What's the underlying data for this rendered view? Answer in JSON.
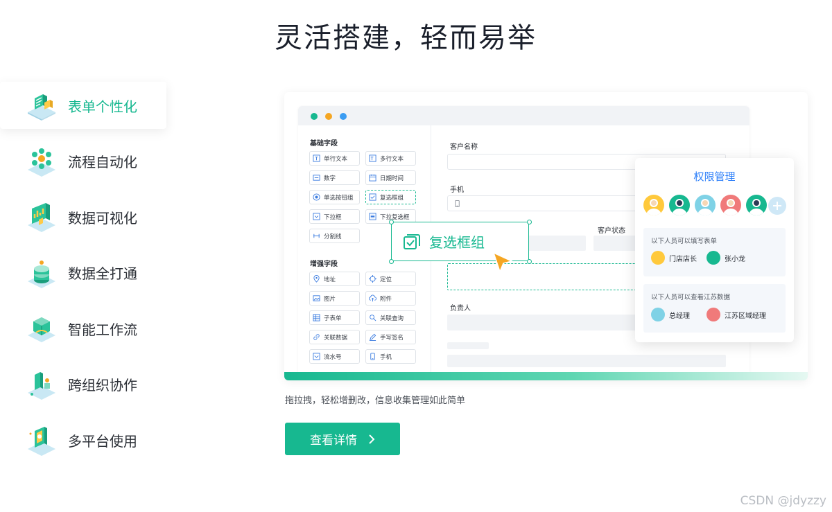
{
  "page": {
    "title": "灵活搭建，轻而易举"
  },
  "menu": {
    "items": [
      {
        "label": "表单个性化",
        "icon": "form-isometric-icon",
        "active": true
      },
      {
        "label": "流程自动化",
        "icon": "workflow-nodes-icon",
        "active": false
      },
      {
        "label": "数据可视化",
        "icon": "chart-board-icon",
        "active": false
      },
      {
        "label": "数据全打通",
        "icon": "database-stack-icon",
        "active": false
      },
      {
        "label": "智能工作流",
        "icon": "smart-flow-icon",
        "active": false
      },
      {
        "label": "跨组织协作",
        "icon": "collaboration-icon",
        "active": false
      },
      {
        "label": "多平台使用",
        "icon": "mobile-device-icon",
        "active": false
      }
    ]
  },
  "builder": {
    "basic_title": "基础字段",
    "basic_fields": [
      "单行文本",
      "多行文本",
      "数字",
      "日期时间",
      "单选按钮组",
      "复选框组",
      "下拉框",
      "下拉复选框",
      "分割线"
    ],
    "enhanced_title": "增强字段",
    "enhanced_fields": [
      "地址",
      "定位",
      "图片",
      "附件",
      "子表单",
      "关联查询",
      "关联数据",
      "手写签名",
      "流水号",
      "手机"
    ],
    "form": {
      "customer_name_label": "客户名称",
      "phone_label": "手机",
      "customer_status_label": "客户状态",
      "owner_label": "负责人"
    },
    "drag_item_label": "复选框组"
  },
  "permission": {
    "title": "权限管理",
    "fill_title": "以下人员可以填写表单",
    "fill_people": [
      "门店店长",
      "张小龙"
    ],
    "view_title": "以下人员可以查看江苏数据",
    "view_people": [
      "总经理",
      "江苏区域经理"
    ]
  },
  "caption": "拖拉拽，轻松增删改，信息收集管理如此简单",
  "cta": {
    "label": "查看详情"
  },
  "watermark": "CSDN @jdyzzy",
  "colors": {
    "accent": "#17b890",
    "blue": "#2d7ff9",
    "dot_green": "#17b890",
    "dot_orange": "#f5a623",
    "dot_blue": "#3b9cf2"
  }
}
